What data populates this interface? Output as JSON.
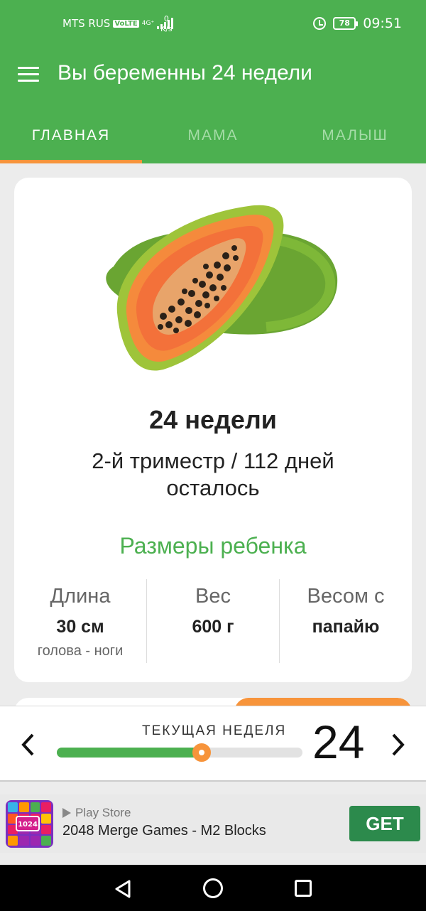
{
  "status_bar": {
    "carrier": "MTS RUS",
    "volte": "VoLTE",
    "network": "4G⁺",
    "speed_value": "0",
    "speed_unit": "K/s",
    "battery": "78",
    "time": "09:51"
  },
  "app_bar": {
    "title": "Вы беременны 24 недели"
  },
  "tabs": [
    {
      "label": "ГЛАВНАЯ",
      "active": true
    },
    {
      "label": "МАМА",
      "active": false
    },
    {
      "label": "МАЛЫШ",
      "active": false
    }
  ],
  "card": {
    "week_title": "24 недели",
    "trimester_line": "2-й триместр / 112 дней осталось",
    "sizes_title": "Размеры ребенка",
    "stats": [
      {
        "label": "Длина",
        "value": "30 см",
        "sub": "голова - ноги"
      },
      {
        "label": "Вес",
        "value": "600 г",
        "sub": ""
      },
      {
        "label": "Весом с",
        "value": "папайю",
        "sub": ""
      }
    ]
  },
  "week_selector": {
    "label": "ТЕКУЩАЯ НЕДЕЛЯ",
    "week": "24",
    "progress": 0.59
  },
  "ad": {
    "store": "Play Store",
    "title": "2048 Merge Games - M2 Blocks",
    "cta": "GET",
    "icon_badge": "1024"
  },
  "colors": {
    "primary": "#4cb050",
    "accent": "#f7943b",
    "ad_button": "#2c8a4c"
  }
}
